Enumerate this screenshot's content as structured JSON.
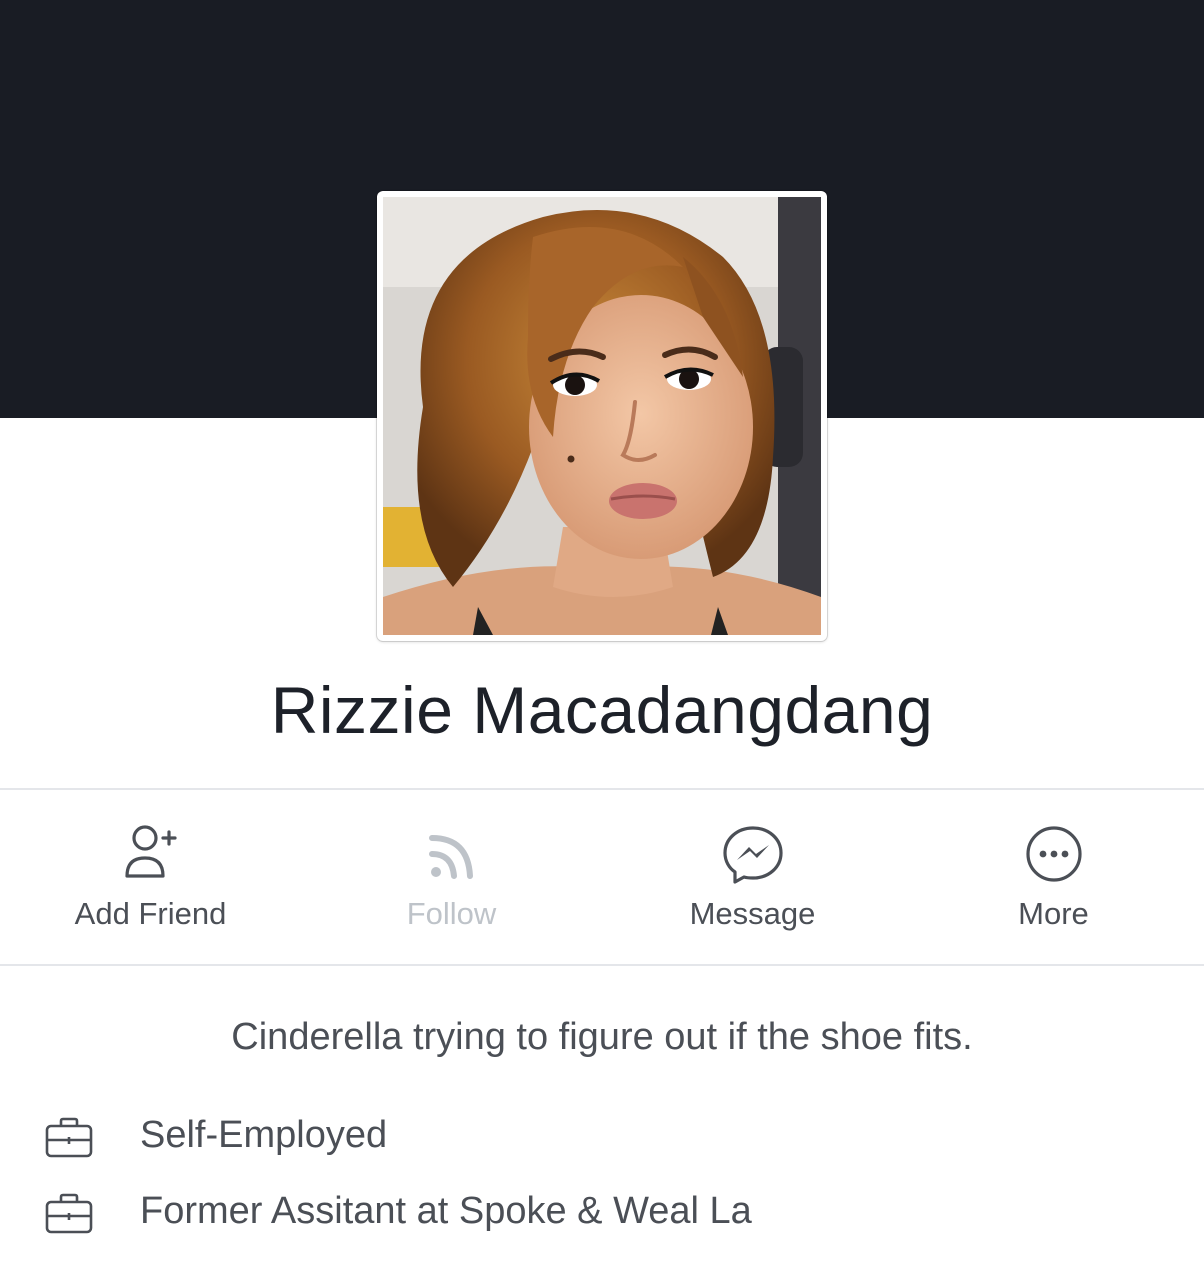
{
  "profile": {
    "name": "Rizzie Macadangdang",
    "bio": "Cinderella trying to figure out if the shoe fits."
  },
  "actions": [
    {
      "label": "Add Friend",
      "icon": "add-friend-icon",
      "enabled": true
    },
    {
      "label": "Follow",
      "icon": "follow-icon",
      "enabled": false
    },
    {
      "label": "Message",
      "icon": "messenger-icon",
      "enabled": true
    },
    {
      "label": "More",
      "icon": "more-icon",
      "enabled": true
    }
  ],
  "info": [
    {
      "icon": "briefcase-icon",
      "text": "Self-Employed"
    },
    {
      "icon": "briefcase-icon",
      "text": "Former Assitant at Spoke & Weal La"
    }
  ],
  "colors": {
    "cover": "#191c24",
    "text_primary": "#1d2129",
    "text_secondary": "#4b4f56",
    "text_disabled": "#bec3c9"
  }
}
